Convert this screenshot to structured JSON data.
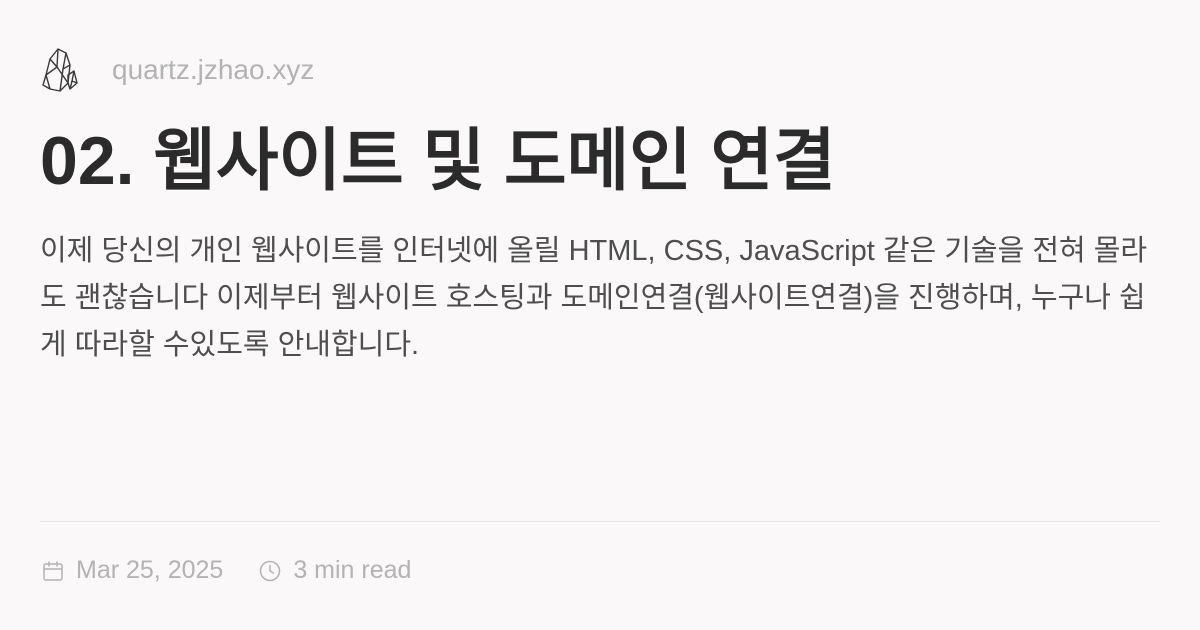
{
  "site": {
    "name": "quartz.jzhao.xyz",
    "logo_icon": "quartz-crystal-icon"
  },
  "article": {
    "title": "02. 웹사이트 및 도메인 연결",
    "description": "이제 당신의 개인 웹사이트를 인터넷에 올릴 HTML, CSS, JavaScript 같은 기술을 전혀 몰라도 괜찮습니다 이제부터 웹사이트 호스팅과 도메인연결(웹사이트연결)을 진행하며, 누구나 쉽게 따라할 수있도록 안내합니다."
  },
  "meta": {
    "date": "Mar 25, 2025",
    "date_icon": "calendar-icon",
    "reading_time": "3 min read",
    "reading_time_icon": "clock-icon"
  },
  "colors": {
    "background": "#faf8f8",
    "title": "#2b2b2b",
    "body": "#4e4e4e",
    "muted": "#b3b3b3",
    "divider": "#e8e6e6"
  }
}
